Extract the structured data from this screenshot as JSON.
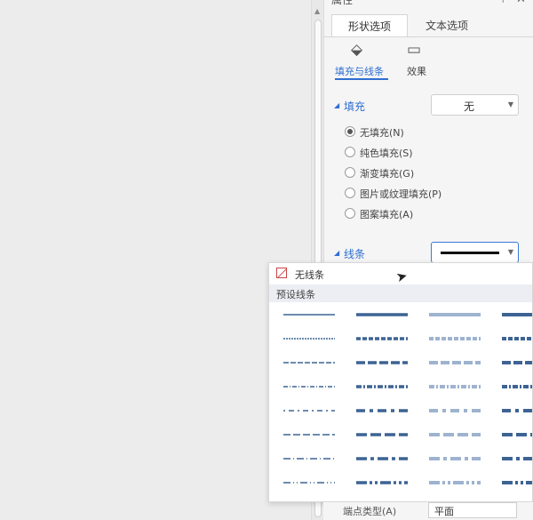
{
  "panel": {
    "title": "属性",
    "tabs": [
      {
        "label": "形状选项",
        "active": true
      },
      {
        "label": "文本选项",
        "active": false
      }
    ],
    "subtabs": [
      {
        "label": "填充与线条",
        "icon": "paint-bucket-icon",
        "active": true
      },
      {
        "label": "效果",
        "icon": "effect-icon",
        "active": false
      }
    ],
    "fill": {
      "title": "填充",
      "dropdown_value": "无",
      "options": [
        {
          "label": "无填充(N)",
          "checked": true
        },
        {
          "label": "纯色填充(S)",
          "checked": false
        },
        {
          "label": "渐变填充(G)",
          "checked": false
        },
        {
          "label": "图片或纹理填充(P)",
          "checked": false
        },
        {
          "label": "图案填充(A)",
          "checked": false
        }
      ]
    },
    "line": {
      "title": "线条"
    }
  },
  "popup": {
    "no_line_label": "无线条",
    "preset_label": "预设线条"
  },
  "bottom": {
    "label": "端点类型(A)",
    "value": "平面"
  },
  "colors": {
    "accent": "#2f6fd0",
    "line_dark": "#3d6394",
    "line_light": "#9db3cf"
  }
}
